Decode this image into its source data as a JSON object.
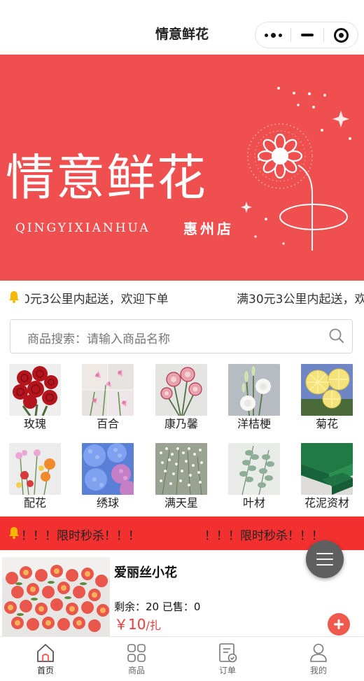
{
  "navbar": {
    "title": "情意鲜花"
  },
  "banner": {
    "title": "情意鲜花",
    "subtitle": "QINGYIXIANHUA",
    "store": "惠州店",
    "bg_color": "#ef4f4f"
  },
  "notice": {
    "text_partial": "0元3公里内起送，欢迎下单",
    "text": "满30元3公里内起送，欢"
  },
  "search": {
    "placeholder": "商品搜索：请输入商品名称"
  },
  "categories": [
    {
      "label": "玫瑰",
      "icon": "rose-photo"
    },
    {
      "label": "百合",
      "icon": "lily-photo"
    },
    {
      "label": "康乃馨",
      "icon": "carnation-photo"
    },
    {
      "label": "洋桔梗",
      "icon": "eustoma-photo"
    },
    {
      "label": "菊花",
      "icon": "chrysanthemum-photo"
    },
    {
      "label": "配花",
      "icon": "filler-flowers-photo"
    },
    {
      "label": "绣球",
      "icon": "hydrangea-photo"
    },
    {
      "label": "满天星",
      "icon": "babys-breath-photo"
    },
    {
      "label": "叶材",
      "icon": "eucalyptus-photo"
    },
    {
      "label": "花泥资材",
      "icon": "floral-foam-photo"
    }
  ],
  "flash_sale": {
    "text1": "！！！限时秒杀！！！",
    "text2": "！！！限时秒杀！！！",
    "bg_color": "#f23030"
  },
  "product": {
    "name": "爱丽丝小花",
    "stock": "剩余：20  已售：0",
    "price": "￥10",
    "unit": "/扎",
    "accent_color": "#f23a3a"
  },
  "tabbar": [
    {
      "label": "首页",
      "icon": "home-icon",
      "active": true
    },
    {
      "label": "商品",
      "icon": "grid-icon",
      "active": false
    },
    {
      "label": "订单",
      "icon": "order-icon",
      "active": false
    },
    {
      "label": "我的",
      "icon": "user-icon",
      "active": false
    }
  ]
}
